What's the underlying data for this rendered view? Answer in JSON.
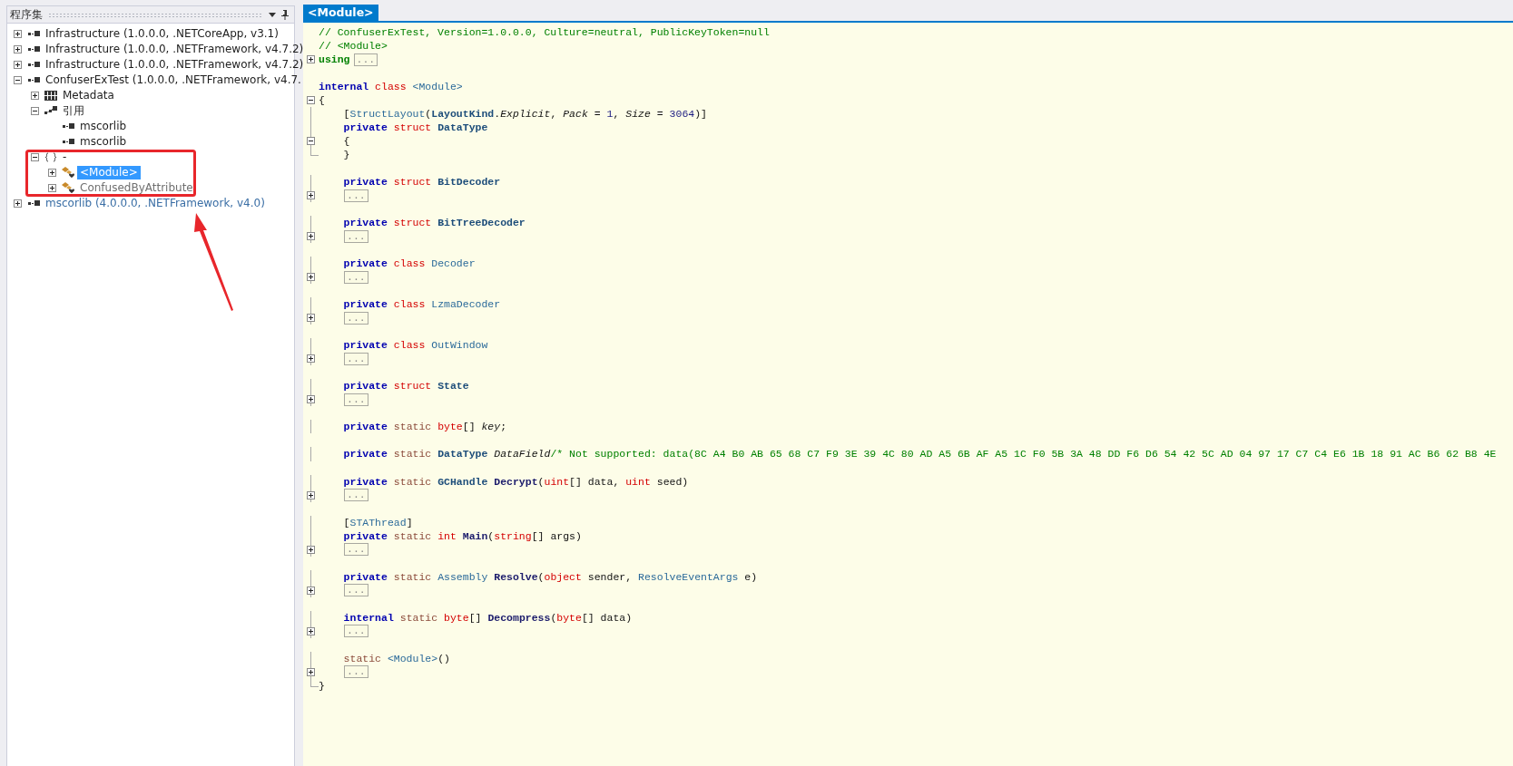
{
  "assembly_panel": {
    "title": "程序集"
  },
  "tree": [
    {
      "label": "Infrastructure (1.0.0.0, .NETCoreApp, v3.1)",
      "kind": "assembly",
      "expanded": false,
      "selected": false
    },
    {
      "label": "Infrastructure (1.0.0.0, .NETFramework, v4.7.2)",
      "kind": "assembly",
      "expanded": false,
      "selected": false
    },
    {
      "label": "Infrastructure (1.0.0.0, .NETFramework, v4.7.2)",
      "kind": "assembly",
      "expanded": false,
      "selected": false
    },
    {
      "label": "ConfuserExTest (1.0.0.0, .NETFramework, v4.7.",
      "kind": "assembly",
      "expanded": true,
      "selected": false,
      "children": [
        {
          "label": "Metadata",
          "kind": "metadata",
          "expanded": false,
          "selected": false
        },
        {
          "label": "引用",
          "kind": "references",
          "expanded": true,
          "selected": false,
          "children": [
            {
              "label": "mscorlib",
              "kind": "assembly",
              "selected": false
            },
            {
              "label": "mscorlib",
              "kind": "assembly",
              "selected": false
            }
          ]
        },
        {
          "label": "-",
          "kind": "namespace",
          "expanded": true,
          "selected": false,
          "children": [
            {
              "label": "<Module>",
              "kind": "class",
              "expanded": false,
              "selected": true
            },
            {
              "label": "ConfusedByAttribute",
              "kind": "class",
              "expanded": false,
              "selected": false,
              "color": "#707070"
            }
          ]
        }
      ]
    },
    {
      "label": "mscorlib (4.0.0.0, .NETFramework, v4.0)",
      "kind": "assembly",
      "expanded": false,
      "selected": false,
      "color": "#3a6ea5"
    }
  ],
  "editor": {
    "tab": {
      "label": "<Module>",
      "selected": true
    },
    "lines": [
      {
        "kind": "code",
        "tokens": [
          {
            "t": "// ConfuserExTest, Version=1.0.0.0, Culture=neutral, PublicKeyToken=null",
            "kind": "comment"
          }
        ]
      },
      {
        "kind": "code",
        "tokens": [
          {
            "t": "// <Module>",
            "kind": "comment"
          }
        ]
      },
      {
        "kind": "code",
        "expanded": false,
        "tokens": [
          {
            "t": "using",
            "kind": "directive"
          }
        ],
        "collapsed": "..."
      },
      {
        "kind": "blank"
      },
      {
        "kind": "code",
        "tokens": [
          {
            "t": "internal",
            "kind": "keyword"
          },
          {
            "t": " class",
            "kind": "type-keyword"
          },
          {
            "t": " <Module>",
            "kind": "type"
          }
        ]
      },
      {
        "kind": "code",
        "expanded": true,
        "tokens": [
          {
            "t": "{",
            "kind": "plain"
          }
        ]
      },
      {
        "kind": "code",
        "tokens": [
          {
            "t": "    [",
            "kind": "plain"
          },
          {
            "t": "StructLayout",
            "kind": "type"
          },
          {
            "t": "(",
            "kind": "plain"
          },
          {
            "t": "LayoutKind",
            "kind": "type-name"
          },
          {
            "t": ".",
            "kind": "plain"
          },
          {
            "t": "Explicit",
            "kind": "italic"
          },
          {
            "t": ", ",
            "kind": "plain"
          },
          {
            "t": "Pack",
            "kind": "italic"
          },
          {
            "t": " = ",
            "kind": "plain"
          },
          {
            "t": "1",
            "kind": "number"
          },
          {
            "t": ", ",
            "kind": "plain"
          },
          {
            "t": "Size",
            "kind": "italic"
          },
          {
            "t": " = ",
            "kind": "plain"
          },
          {
            "t": "3064",
            "kind": "number"
          },
          {
            "t": ")]",
            "kind": "plain"
          }
        ]
      },
      {
        "kind": "code",
        "tokens": [
          {
            "t": "    private",
            "kind": "keyword"
          },
          {
            "t": " struct",
            "kind": "type-keyword"
          },
          {
            "t": " DataType",
            "kind": "type-name"
          }
        ]
      },
      {
        "kind": "code",
        "expanded": true,
        "tokens": [
          {
            "t": "    {",
            "kind": "plain"
          }
        ]
      },
      {
        "kind": "block-end",
        "tokens": [
          {
            "t": "    }",
            "kind": "plain"
          }
        ]
      },
      {
        "kind": "blank"
      },
      {
        "kind": "code",
        "tokens": [
          {
            "t": "    private",
            "kind": "keyword"
          },
          {
            "t": " struct",
            "kind": "type-keyword"
          },
          {
            "t": " BitDecoder",
            "kind": "type-name"
          }
        ]
      },
      {
        "kind": "code",
        "expanded": false,
        "collapsed": "..."
      },
      {
        "kind": "blank"
      },
      {
        "kind": "code",
        "tokens": [
          {
            "t": "    private",
            "kind": "keyword"
          },
          {
            "t": " struct",
            "kind": "type-keyword"
          },
          {
            "t": " BitTreeDecoder",
            "kind": "type-name"
          }
        ]
      },
      {
        "kind": "code",
        "expanded": false,
        "collapsed": "..."
      },
      {
        "kind": "blank"
      },
      {
        "kind": "code",
        "tokens": [
          {
            "t": "    private",
            "kind": "keyword"
          },
          {
            "t": " class",
            "kind": "type-keyword"
          },
          {
            "t": " Decoder",
            "kind": "type"
          }
        ]
      },
      {
        "kind": "code",
        "expanded": false,
        "collapsed": "..."
      },
      {
        "kind": "blank"
      },
      {
        "kind": "code",
        "tokens": [
          {
            "t": "    private",
            "kind": "keyword"
          },
          {
            "t": " class",
            "kind": "type-keyword"
          },
          {
            "t": " LzmaDecoder",
            "kind": "type"
          }
        ]
      },
      {
        "kind": "code",
        "expanded": false,
        "collapsed": "..."
      },
      {
        "kind": "blank"
      },
      {
        "kind": "code",
        "tokens": [
          {
            "t": "    private",
            "kind": "keyword"
          },
          {
            "t": " class",
            "kind": "type-keyword"
          },
          {
            "t": " OutWindow",
            "kind": "type"
          }
        ]
      },
      {
        "kind": "code",
        "expanded": false,
        "collapsed": "..."
      },
      {
        "kind": "blank"
      },
      {
        "kind": "code",
        "tokens": [
          {
            "t": "    private",
            "kind": "keyword"
          },
          {
            "t": " struct",
            "kind": "type-keyword"
          },
          {
            "t": " State",
            "kind": "type-name"
          }
        ]
      },
      {
        "kind": "code",
        "expanded": false,
        "collapsed": "..."
      },
      {
        "kind": "blank"
      },
      {
        "kind": "code",
        "tokens": [
          {
            "t": "    private",
            "kind": "keyword"
          },
          {
            "t": " static",
            "kind": "modifier"
          },
          {
            "t": " byte",
            "kind": "type-keyword"
          },
          {
            "t": "[] ",
            "kind": "plain"
          },
          {
            "t": "key",
            "kind": "italic"
          },
          {
            "t": ";",
            "kind": "plain"
          }
        ]
      },
      {
        "kind": "blank"
      },
      {
        "kind": "code",
        "tokens": [
          {
            "t": "    private",
            "kind": "keyword"
          },
          {
            "t": " static",
            "kind": "modifier"
          },
          {
            "t": " DataType ",
            "kind": "type-name"
          },
          {
            "t": "DataField",
            "kind": "italic"
          },
          {
            "t": "/* Not supported: data(8C A4 B0 AB 65 68 C7 F9 3E 39 4C 80 AD A5 6B AF A5 1C F0 5B 3A 48 DD F6 D6 54 42 5C AD 04 97 17 C7 C4 E6 1B 18 91 AC B6 62 B8 4E",
            "kind": "comment"
          }
        ]
      },
      {
        "kind": "blank"
      },
      {
        "kind": "code",
        "tokens": [
          {
            "t": "    private",
            "kind": "keyword"
          },
          {
            "t": " static",
            "kind": "modifier"
          },
          {
            "t": " GCHandle",
            "kind": "type-name"
          },
          {
            "t": " Decrypt",
            "kind": "method"
          },
          {
            "t": "(",
            "kind": "plain"
          },
          {
            "t": "uint",
            "kind": "type-keyword"
          },
          {
            "t": "[] data, ",
            "kind": "plain"
          },
          {
            "t": "uint",
            "kind": "type-keyword"
          },
          {
            "t": " seed)",
            "kind": "plain"
          }
        ]
      },
      {
        "kind": "code",
        "expanded": false,
        "collapsed": "..."
      },
      {
        "kind": "blank"
      },
      {
        "kind": "code",
        "tokens": [
          {
            "t": "    [",
            "kind": "plain"
          },
          {
            "t": "STAThread",
            "kind": "type"
          },
          {
            "t": "]",
            "kind": "plain"
          }
        ]
      },
      {
        "kind": "code",
        "tokens": [
          {
            "t": "    private",
            "kind": "keyword"
          },
          {
            "t": " static",
            "kind": "modifier"
          },
          {
            "t": " int",
            "kind": "type-keyword"
          },
          {
            "t": " Main",
            "kind": "method"
          },
          {
            "t": "(",
            "kind": "plain"
          },
          {
            "t": "string",
            "kind": "type-keyword"
          },
          {
            "t": "[] args)",
            "kind": "plain"
          }
        ]
      },
      {
        "kind": "code",
        "expanded": false,
        "collapsed": "..."
      },
      {
        "kind": "blank"
      },
      {
        "kind": "code",
        "tokens": [
          {
            "t": "    private",
            "kind": "keyword"
          },
          {
            "t": " static",
            "kind": "modifier"
          },
          {
            "t": " Assembly",
            "kind": "type"
          },
          {
            "t": " Resolve",
            "kind": "method"
          },
          {
            "t": "(",
            "kind": "plain"
          },
          {
            "t": "object",
            "kind": "type-keyword"
          },
          {
            "t": " sender, ",
            "kind": "plain"
          },
          {
            "t": "ResolveEventArgs",
            "kind": "type"
          },
          {
            "t": " e)",
            "kind": "plain"
          }
        ]
      },
      {
        "kind": "code",
        "expanded": false,
        "collapsed": "..."
      },
      {
        "kind": "blank"
      },
      {
        "kind": "code",
        "tokens": [
          {
            "t": "    internal",
            "kind": "keyword"
          },
          {
            "t": " static",
            "kind": "modifier"
          },
          {
            "t": " byte",
            "kind": "type-keyword"
          },
          {
            "t": "[] ",
            "kind": "plain"
          },
          {
            "t": "Decompress",
            "kind": "method"
          },
          {
            "t": "(",
            "kind": "plain"
          },
          {
            "t": "byte",
            "kind": "type-keyword"
          },
          {
            "t": "[] data)",
            "kind": "plain"
          }
        ]
      },
      {
        "kind": "code",
        "expanded": false,
        "collapsed": "..."
      },
      {
        "kind": "blank"
      },
      {
        "kind": "code",
        "tokens": [
          {
            "t": "    static",
            "kind": "modifier"
          },
          {
            "t": " <Module>",
            "kind": "type"
          },
          {
            "t": "()",
            "kind": "plain"
          }
        ]
      },
      {
        "kind": "code",
        "expanded": false,
        "collapsed": "..."
      },
      {
        "kind": "block-end",
        "tokens": [
          {
            "t": "}",
            "kind": "plain"
          }
        ]
      }
    ]
  }
}
